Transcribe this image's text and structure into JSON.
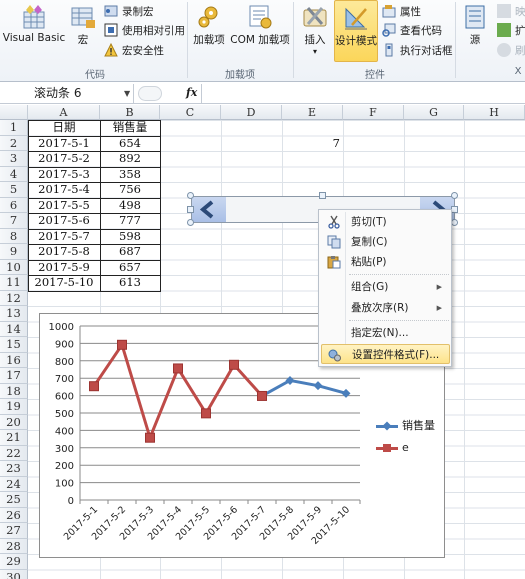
{
  "ribbon": {
    "groups": [
      {
        "label": "代码"
      },
      {
        "label": "加载项"
      },
      {
        "label": "控件"
      },
      {
        "label": "X"
      }
    ],
    "code": {
      "visual_basic": "Visual Basic",
      "macros": "宏",
      "record_macro": "录制宏",
      "relative_ref": "使用相对引用",
      "macro_security": "宏安全性"
    },
    "addins": {
      "addins": "加载项",
      "com_addins": "COM 加载项"
    },
    "controls": {
      "insert": "插入",
      "insert_arrow": "▾",
      "design_mode": "设计模式",
      "properties": "属性",
      "view_code": "查看代码",
      "run_dialog": "执行对话框"
    },
    "xml": {
      "source": "源",
      "map_props": "映",
      "expansion": "扩",
      "refresh": "刷"
    },
    "colors": {
      "active_bg": "#fbd65a"
    }
  },
  "formula_bar": {
    "name_box": "滚动条 6",
    "fx": "fx",
    "formula": ""
  },
  "sheet": {
    "columns": [
      "A",
      "B",
      "C",
      "D",
      "E",
      "F",
      "G",
      "H"
    ],
    "rows": [
      "1",
      "2",
      "3",
      "4",
      "5",
      "6",
      "7",
      "8",
      "9",
      "10",
      "11",
      "12",
      "13",
      "14",
      "15",
      "16",
      "17",
      "18",
      "19",
      "20",
      "21",
      "22",
      "23",
      "24",
      "25",
      "26",
      "27",
      "28",
      "29",
      "30"
    ],
    "table_header": [
      "日期",
      "销售量"
    ],
    "table_rows": [
      [
        "2017-5-1",
        "654"
      ],
      [
        "2017-5-2",
        "892"
      ],
      [
        "2017-5-3",
        "358"
      ],
      [
        "2017-5-4",
        "756"
      ],
      [
        "2017-5-5",
        "498"
      ],
      [
        "2017-5-6",
        "777"
      ],
      [
        "2017-5-7",
        "598"
      ],
      [
        "2017-5-8",
        "687"
      ],
      [
        "2017-5-9",
        "657"
      ],
      [
        "2017-5-10",
        "613"
      ]
    ],
    "e2_value": "7"
  },
  "scrollbar_control": {
    "name": "滚动条 6",
    "left_arrow": "‹",
    "right_arrow": "›"
  },
  "context_menu": {
    "items": [
      {
        "label": "剪切(T)",
        "icon": "scissors-icon"
      },
      {
        "label": "复制(C)",
        "icon": "copy-icon"
      },
      {
        "label": "粘贴(P)",
        "icon": "paste-icon"
      },
      {
        "label": "组合(G)",
        "submenu": true
      },
      {
        "label": "叠放次序(R)",
        "submenu": true
      },
      {
        "label": "指定宏(N)..."
      },
      {
        "label": "设置控件格式(F)...",
        "icon": "format-control-icon",
        "highlighted": true
      }
    ],
    "submenu_arrow": "▶"
  },
  "chart_data": {
    "type": "line",
    "title": "",
    "categories": [
      "2017-5-1",
      "2017-5-2",
      "2017-5-3",
      "2017-5-4",
      "2017-5-5",
      "2017-5-6",
      "2017-5-7",
      "2017-5-8",
      "2017-5-9",
      "2017-5-10"
    ],
    "series": [
      {
        "name": "销售量",
        "color": "#4a7ebb",
        "marker": "diamond",
        "values": [
          null,
          null,
          null,
          null,
          null,
          null,
          598,
          687,
          657,
          613
        ]
      },
      {
        "name": "e",
        "color": "#be4b48",
        "marker": "square",
        "values": [
          654,
          892,
          358,
          756,
          498,
          777,
          598,
          null,
          null,
          null
        ]
      }
    ],
    "xlabel": "",
    "ylabel": "",
    "ylim": [
      0,
      1000
    ],
    "yticks": [
      0,
      100,
      200,
      300,
      400,
      500,
      600,
      700,
      800,
      900,
      1000
    ],
    "grid": true,
    "legend": "right"
  }
}
